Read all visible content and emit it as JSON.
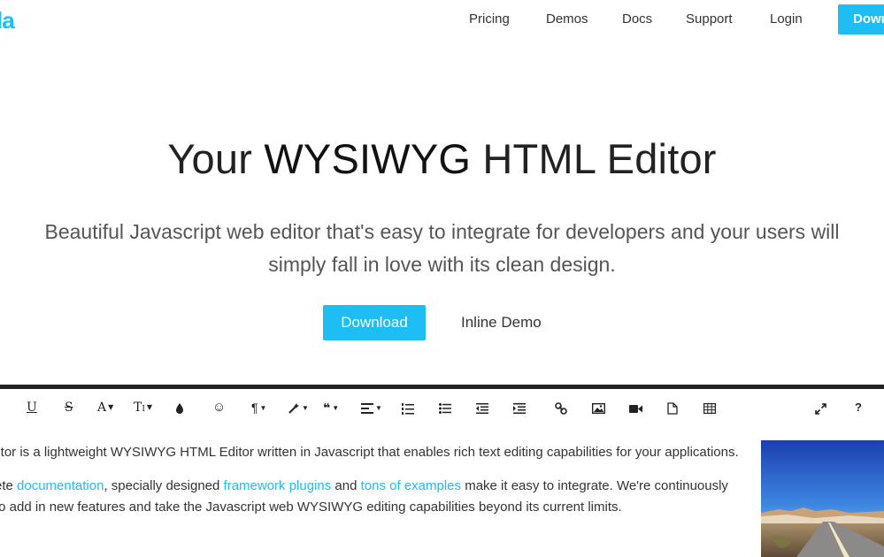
{
  "header": {
    "logo": "la",
    "nav": [
      "Pricing",
      "Demos",
      "Docs",
      "Support",
      "Login"
    ],
    "cta": "Download"
  },
  "hero": {
    "title_pre": "Your ",
    "title_bold": "WYSIWYG",
    "title_post": " HTML Editor",
    "subtitle_line1": "Beautiful Javascript web editor that's easy to integrate for developers and your users will",
    "subtitle_line2": "simply fall in love with its clean design.",
    "download_label": "Download",
    "inline_demo_label": "Inline Demo"
  },
  "toolbar": {
    "underline": "U",
    "strike": "S",
    "font_family": "A",
    "font_size": "T",
    "emoticon": "☺",
    "paragraph": "¶",
    "quote": "❝",
    "help": "?"
  },
  "editor": {
    "line1": "litor is a lightweight WYSIWYG HTML Editor written in Javascript that enables rich text editing capabilities for your applications.",
    "line2_a": "ete ",
    "line2_link1": "documentation",
    "line2_b": ", specially designed ",
    "line2_link2": "framework plugins",
    "line2_c": " and ",
    "line2_link3": "tons of examples",
    "line2_d": " make it easy to integrate. We're continuously",
    "line3": "to add in new features and take the Javascript web WYSIWYG editing capabilities beyond its current limits."
  },
  "colors": {
    "accent": "#1ebdf4"
  }
}
